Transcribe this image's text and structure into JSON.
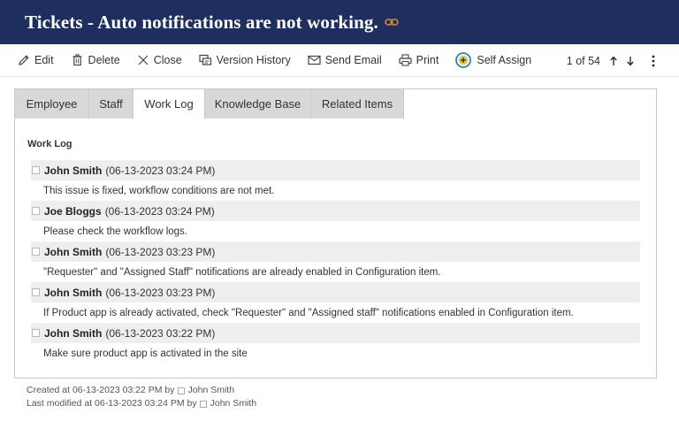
{
  "title": "Tickets - Auto notifications are not working.",
  "colors": {
    "header_bg": "#1e2e5e",
    "link_icon": "#d08a2a",
    "self_assign_accent": "#2a7fd4"
  },
  "toolbar": {
    "edit": "Edit",
    "delete": "Delete",
    "close": "Close",
    "version_history": "Version History",
    "send_email": "Send Email",
    "print": "Print",
    "self_assign": "Self Assign",
    "pager": "1 of 54",
    "icons": [
      "pencil-icon",
      "trash-icon",
      "close-icon",
      "version-history-icon",
      "envelope-icon",
      "printer-icon",
      "self-assign-icon",
      "arrow-up-icon",
      "arrow-down-icon",
      "more-vertical-icon"
    ]
  },
  "tabs": [
    "Employee",
    "Staff",
    "Work Log",
    "Knowledge Base",
    "Related Items"
  ],
  "active_tab": "Work Log",
  "worklog": {
    "heading": "Work Log",
    "entries": [
      {
        "author": "John Smith",
        "timestamp": "(06-13-2023 03:24 PM)",
        "text": "This issue is fixed, workflow conditions are not met."
      },
      {
        "author": "Joe Bloggs",
        "timestamp": "(06-13-2023 03:24 PM)",
        "text": "Please check the workflow logs."
      },
      {
        "author": "John Smith",
        "timestamp": "(06-13-2023 03:23 PM)",
        "text": "\"Requester\" and \"Assigned Staff\" notifications are already enabled in Configuration item."
      },
      {
        "author": "John Smith",
        "timestamp": "(06-13-2023 03:23 PM)",
        "text": "If Product app is already activated, check \"Requester\" and \"Assigned staff\" notifications enabled in Configuration item."
      },
      {
        "author": "John Smith",
        "timestamp": "(06-13-2023 03:22 PM)",
        "text": "Make sure product app is activated in the site"
      }
    ]
  },
  "meta": {
    "created_prefix": "Created at 06-13-2023 03:22 PM by",
    "created_by": "John Smith",
    "modified_prefix": "Last modified at 06-13-2023 03:24 PM by",
    "modified_by": "John Smith"
  }
}
